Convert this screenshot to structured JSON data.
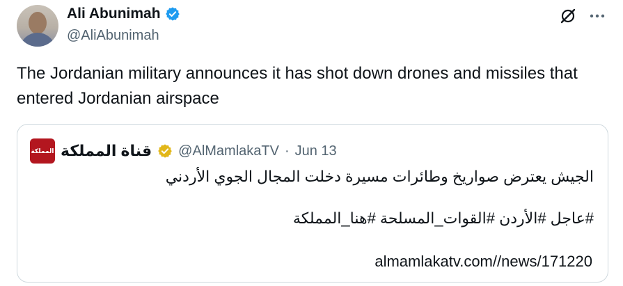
{
  "author": {
    "display_name": "Ali Abunimah",
    "handle": "@AliAbunimah",
    "badge_color": "#1d9bf0"
  },
  "icons": {
    "grok": "grok-icon",
    "more": "more-icon"
  },
  "tweet": {
    "text": "The Jordanian military announces it has shot down drones and missiles that entered Jordanian airspace"
  },
  "quote": {
    "display_name": "قناة المملكة",
    "logo_text": "المملكة",
    "handle": "@AlMamlakaTV",
    "separator": "·",
    "date": "Jun 13",
    "badge_color": "#e2b719",
    "line1": "الجيش يعترض صواريخ وطائرات مسيرة دخلت المجال الجوي الأردني",
    "line2": "#عاجل #الأردن #القوات_المسلحة #هنا_المملكة",
    "link": "almamlakatv.com//news/171220"
  }
}
